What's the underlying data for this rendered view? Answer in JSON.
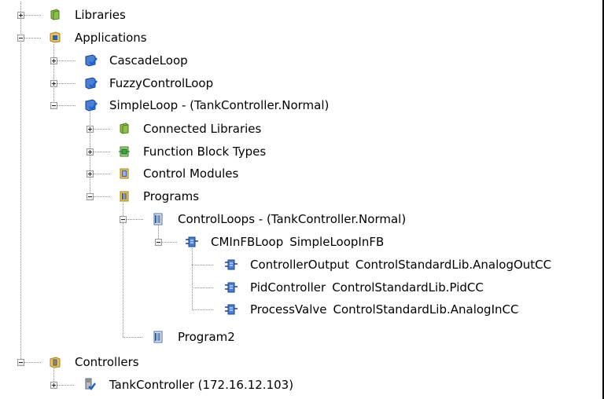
{
  "tree": {
    "libraries": {
      "label": "Libraries"
    },
    "applications": {
      "label": "Applications",
      "cascade_loop": {
        "label": "CascadeLoop"
      },
      "fuzzy_control_loop": {
        "label": "FuzzyControlLoop"
      },
      "simple_loop": {
        "label": "SimpleLoop - (TankController.Normal)",
        "connected_libraries": {
          "label": "Connected Libraries"
        },
        "function_block_types": {
          "label": "Function Block Types"
        },
        "control_modules": {
          "label": "Control Modules"
        },
        "programs": {
          "label": "Programs",
          "control_loops": {
            "label": "ControlLoops - (TankController.Normal)",
            "cminfbloop": {
              "name": "CMInFBLoop",
              "type": "SimpleLoopInFB",
              "controller_output": {
                "name": "ControllerOutput",
                "type": "ControlStandardLib.AnalogOutCC"
              },
              "pid_controller": {
                "name": "PidController",
                "type": "ControlStandardLib.PidCC"
              },
              "process_valve": {
                "name": "ProcessValve",
                "type": "ControlStandardLib.AnalogInCC"
              }
            }
          },
          "program2": {
            "label": "Program2"
          }
        }
      }
    },
    "controllers": {
      "label": "Controllers",
      "tank_controller": {
        "label": "TankController (172.16.12.103)"
      }
    }
  },
  "icon_colors": {
    "library_green": "#5f9a2a",
    "application_blue": "#2f5fb8",
    "folder_yellow": "#e8c35a",
    "check_blue": "#1f63c9",
    "fb_green": "#39a64a"
  }
}
